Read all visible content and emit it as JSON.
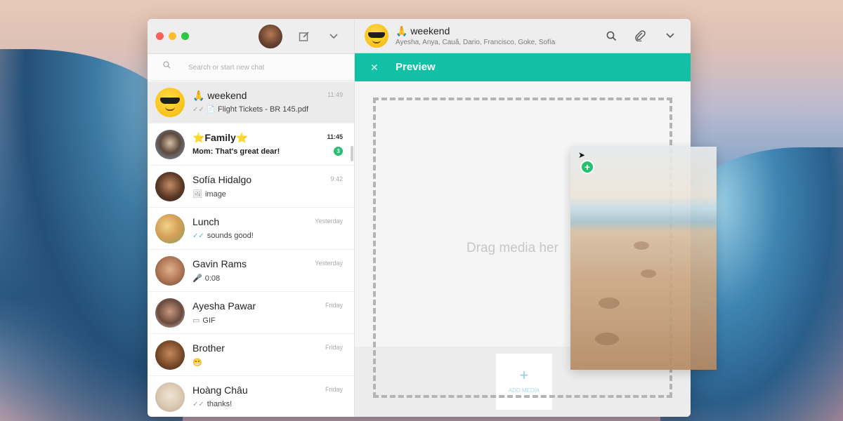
{
  "sidebar": {
    "search_placeholder": "Search or start new chat",
    "chats": [
      {
        "name": "🙏 weekend",
        "time": "11:49",
        "preview": "Flight Tickets - BR 145.pdf",
        "preview_icon": "✓✓ 📄",
        "active": true,
        "avatar_color": "#f9c11a",
        "avatar": "sunglasses-emoji"
      },
      {
        "name": "⭐Family⭐",
        "time": "11:45",
        "preview": "Mom: That's great dear!",
        "preview_icon": "",
        "unread": "3",
        "bold": true,
        "avatar_color": "#7d9cc0",
        "avatar": "pug-photo"
      },
      {
        "name": "Sofía Hidalgo",
        "time": "9:42",
        "preview": "image",
        "preview_icon": "🖼",
        "avatar_color": "#5c3a26",
        "avatar": "sofia-photo"
      },
      {
        "name": "Lunch",
        "time": "Yesterday",
        "preview": "sounds good!",
        "preview_icon": "✓✓",
        "tick_blue": true,
        "avatar_color": "#d6a15a",
        "avatar": "food-photo"
      },
      {
        "name": "Gavin Rams",
        "time": "Yesterday",
        "preview": "0:08",
        "preview_icon": "🎤",
        "avatar_color": "#b47a58",
        "avatar": "gavin-photo"
      },
      {
        "name": "Ayesha Pawar",
        "time": "Friday",
        "preview": "GIF",
        "preview_icon": "▭",
        "avatar_color": "#6a4a3d",
        "avatar": "ayesha-photo"
      },
      {
        "name": "Brother",
        "time": "Friday",
        "preview": "😁",
        "preview_icon": "",
        "avatar_color": "#7a4a2a",
        "avatar": "brother-photo"
      },
      {
        "name": "Hoàng Châu",
        "time": "Friday",
        "preview": "thanks!",
        "preview_icon": "✓✓",
        "avatar_color": "#d9c7b0",
        "avatar": "hoang-photo"
      }
    ]
  },
  "conversation": {
    "title": "🙏 weekend",
    "members": "Ayesha, Anya, Cauã, Dario, Francisco, Goke, Sofía",
    "preview_title": "Preview",
    "drop_hint": "Drag media her",
    "add_media_label": "ADD MEDIA"
  },
  "colors": {
    "accent": "#12c1a5",
    "unread_green": "#25c16f"
  },
  "icons": {
    "compose": "compose-icon",
    "menu": "chevron-down-icon",
    "search": "search-icon",
    "attach": "paperclip-icon",
    "close": "close-icon"
  }
}
